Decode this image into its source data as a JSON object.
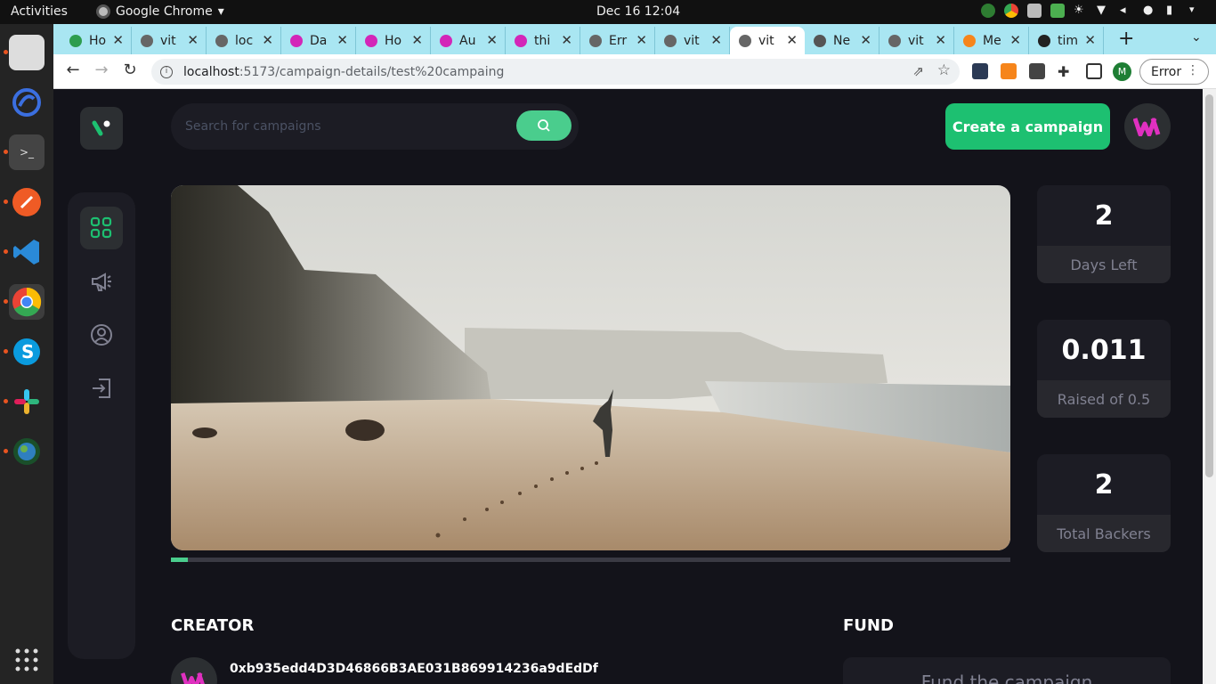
{
  "os": {
    "activities": "Activities",
    "app_name": "Google Chrome",
    "clock": "Dec 16  12:04"
  },
  "dock": {
    "items": [
      "files",
      "stacer",
      "terminal",
      "postman",
      "vscode",
      "chrome",
      "skype",
      "slack",
      "globe"
    ]
  },
  "browser": {
    "tabs": [
      {
        "label": "Ho",
        "icon": "green-tab-icon"
      },
      {
        "label": "vit",
        "icon": "globe-tab-icon"
      },
      {
        "label": "loc",
        "icon": "globe-tab-icon"
      },
      {
        "label": "Da",
        "icon": "w-tab-icon"
      },
      {
        "label": "Ho",
        "icon": "w-tab-icon"
      },
      {
        "label": "Au",
        "icon": "w-tab-icon"
      },
      {
        "label": "thi",
        "icon": "w-tab-icon"
      },
      {
        "label": "Err",
        "icon": "globe-tab-icon"
      },
      {
        "label": "vit",
        "icon": "globe-tab-icon"
      },
      {
        "label": "vit",
        "icon": "globe-tab-icon",
        "active": true
      },
      {
        "label": "Ne",
        "icon": "chrome-tab-icon"
      },
      {
        "label": "vit",
        "icon": "globe-tab-icon"
      },
      {
        "label": "Me",
        "icon": "fox-tab-icon"
      },
      {
        "label": "tim",
        "icon": "github-tab-icon"
      }
    ],
    "url_host": "localhost",
    "url_path": ":5173/campaign-details/test%20campaing",
    "profile_initial": "M",
    "error_label": "Error"
  },
  "app": {
    "search_placeholder": "Search for campaigns",
    "create_button": "Create a campaign",
    "progress_fraction": 0.02,
    "stats": [
      {
        "value": "2",
        "label": "Days Left"
      },
      {
        "value": "0.011",
        "label": "Raised of 0.5"
      },
      {
        "value": "2",
        "label": "Total Backers"
      }
    ],
    "creator_title": "CREATOR",
    "creator_address": "0xb935edd4D3D46866B3AE031B869914236a9dEdDf",
    "fund_title": "FUND",
    "fund_box_title": "Fund the campaign",
    "colors": {
      "accent": "#1dc071",
      "accent_light": "#4acd8d",
      "bg": "#13131a",
      "card": "#1c1c24"
    }
  }
}
